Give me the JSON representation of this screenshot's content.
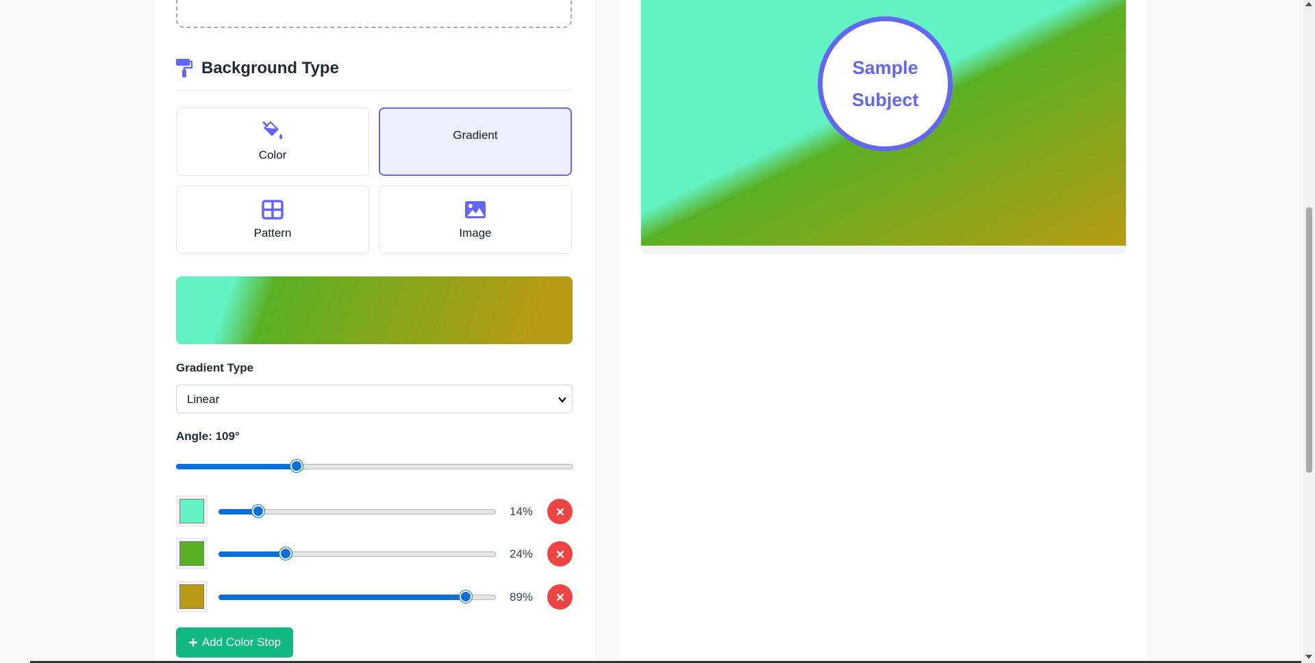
{
  "section": {
    "title": "Background Type"
  },
  "background_types": [
    {
      "label": "Color",
      "icon": "paint-bucket-icon"
    },
    {
      "label": "Gradient",
      "icon": "",
      "selected": true
    },
    {
      "label": "Pattern",
      "icon": "grid-icon"
    },
    {
      "label": "Image",
      "icon": "image-icon"
    }
  ],
  "gradient": {
    "type_label": "Gradient Type",
    "type_value": "Linear",
    "angle_label": "Angle: 109°",
    "angle_value": 109,
    "angle_max": 360,
    "stops": [
      {
        "color": "#63f2c3",
        "position": 14,
        "position_label": "14%"
      },
      {
        "color": "#5ab023",
        "position": 24,
        "position_label": "24%"
      },
      {
        "color": "#b69b13",
        "position": 89,
        "position_label": "89%"
      }
    ],
    "add_stop_label": "Add Color Stop"
  },
  "preview": {
    "subject_line1": "Sample",
    "subject_line2": "Subject"
  },
  "colors": {
    "accent": "#6366f1",
    "danger": "#ef4444",
    "success": "#10b981",
    "slider": "#0b6fd6"
  }
}
